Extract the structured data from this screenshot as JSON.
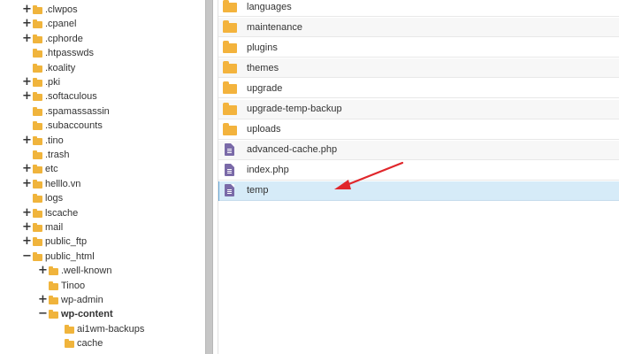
{
  "tree": {
    "items": [
      {
        "label": ".clwpos",
        "expander": "+",
        "icon": "folder-icon",
        "bold": false
      },
      {
        "label": ".cpanel",
        "expander": "+",
        "icon": "folder-icon",
        "bold": false
      },
      {
        "label": ".cphorde",
        "expander": "+",
        "icon": "folder-icon",
        "bold": false
      },
      {
        "label": ".htpasswds",
        "expander": "",
        "icon": "folder-icon",
        "bold": false
      },
      {
        "label": ".koality",
        "expander": "",
        "icon": "folder-icon",
        "bold": false
      },
      {
        "label": ".pki",
        "expander": "+",
        "icon": "folder-icon",
        "bold": false
      },
      {
        "label": ".softaculous",
        "expander": "+",
        "icon": "folder-icon",
        "bold": false
      },
      {
        "label": ".spamassassin",
        "expander": "",
        "icon": "folder-icon",
        "bold": false
      },
      {
        "label": ".subaccounts",
        "expander": "",
        "icon": "folder-icon",
        "bold": false
      },
      {
        "label": ".tino",
        "expander": "+",
        "icon": "folder-icon",
        "bold": false
      },
      {
        "label": ".trash",
        "expander": "",
        "icon": "folder-icon",
        "bold": false
      },
      {
        "label": "etc",
        "expander": "+",
        "icon": "folder-icon",
        "bold": false
      },
      {
        "label": "helllo.vn",
        "expander": "+",
        "icon": "folder-icon",
        "bold": false
      },
      {
        "label": "logs",
        "expander": "",
        "icon": "folder-icon",
        "bold": false
      },
      {
        "label": "lscache",
        "expander": "+",
        "icon": "folder-icon",
        "bold": false
      },
      {
        "label": "mail",
        "expander": "+",
        "icon": "folder-icon",
        "bold": false
      },
      {
        "label": "public_ftp",
        "expander": "+",
        "icon": "folder-icon",
        "bold": false
      },
      {
        "label": "public_html",
        "expander": "−",
        "icon": "folder-open-icon",
        "bold": false
      },
      {
        "label": ".well-known",
        "expander": "+",
        "icon": "folder-icon",
        "bold": false
      },
      {
        "label": "Tinoo",
        "expander": "",
        "icon": "folder-icon",
        "bold": false
      },
      {
        "label": "wp-admin",
        "expander": "+",
        "icon": "folder-icon",
        "bold": false
      },
      {
        "label": "wp-content",
        "expander": "−",
        "icon": "folder-open-icon",
        "bold": true
      },
      {
        "label": "ai1wm-backups",
        "expander": "",
        "icon": "folder-icon",
        "bold": false
      },
      {
        "label": "cache",
        "expander": "",
        "icon": "folder-icon",
        "bold": false
      }
    ]
  },
  "files": {
    "rows": [
      {
        "name": "languages",
        "type": "folder",
        "icon": "folder-icon",
        "selected": false
      },
      {
        "name": "maintenance",
        "type": "folder",
        "icon": "folder-icon",
        "selected": false
      },
      {
        "name": "plugins",
        "type": "folder",
        "icon": "folder-icon",
        "selected": false
      },
      {
        "name": "themes",
        "type": "folder",
        "icon": "folder-icon",
        "selected": false
      },
      {
        "name": "upgrade",
        "type": "folder",
        "icon": "folder-icon",
        "selected": false
      },
      {
        "name": "upgrade-temp-backup",
        "type": "folder",
        "icon": "folder-icon",
        "selected": false
      },
      {
        "name": "uploads",
        "type": "folder",
        "icon": "folder-icon",
        "selected": false
      },
      {
        "name": "advanced-cache.php",
        "type": "file",
        "icon": "file-icon",
        "selected": false
      },
      {
        "name": "index.php",
        "type": "file",
        "icon": "file-icon",
        "selected": false
      },
      {
        "name": "temp",
        "type": "file",
        "icon": "file-icon",
        "selected": true
      }
    ]
  },
  "colors": {
    "folder": "#f3b33d",
    "file": "#7a6aa8",
    "selected_row": "#d6ebf8",
    "annotation_arrow": "#e0262b",
    "divider": "#c6c6c6"
  },
  "annotation": {
    "icon": "red-arrow-icon"
  }
}
